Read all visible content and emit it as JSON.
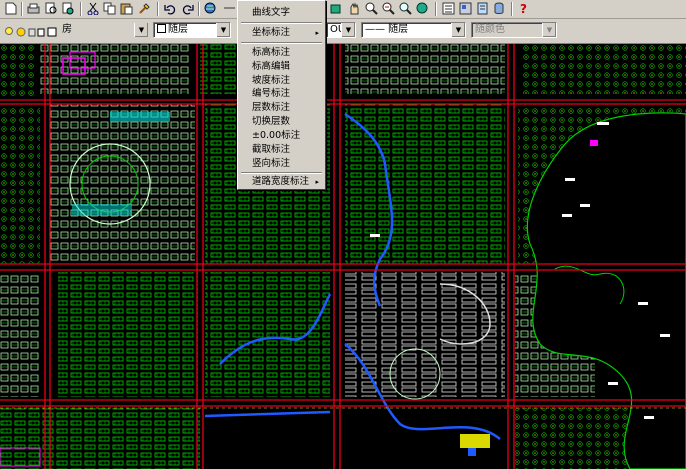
{
  "toolbar": {
    "buttons": [
      "new-icon",
      "print-icon",
      "print-preview-icon",
      "publish-icon",
      "cut-icon",
      "copy-icon",
      "paste-icon",
      "match-properties-icon",
      "undo-icon",
      "redo-icon",
      "globe-icon"
    ],
    "right_buttons": [
      "pan-icon",
      "zoom-realtime-icon",
      "zoom-window-icon",
      "zoom-previous-icon",
      "properties-icon",
      "design-center-icon",
      "tool-palette-icon",
      "help-icon"
    ],
    "help_glyph": "?"
  },
  "layers": {
    "layer_value": "房",
    "color_value": "随层",
    "linetype_value": "OUS",
    "lineweight_value": "—— 随层",
    "plotstyle_value": "随颜色"
  },
  "menu": {
    "items": [
      {
        "label": "曲线文字",
        "submenu": false
      },
      {
        "label": "坐标标注",
        "submenu": true
      },
      {
        "label": "标高标注",
        "submenu": false
      },
      {
        "label": "标高编辑",
        "submenu": false
      },
      {
        "label": "坡度标注",
        "submenu": false
      },
      {
        "label": "编号标注",
        "submenu": false
      },
      {
        "label": "层数标注",
        "submenu": false
      },
      {
        "label": "切换层数",
        "submenu": false
      },
      {
        "label": "±0.00标注",
        "submenu": false
      },
      {
        "label": "截取标注",
        "submenu": false
      },
      {
        "label": "竖向标注",
        "submenu": false
      },
      {
        "label": "道路宽度标注",
        "submenu": true
      }
    ],
    "submenu_arrow": "▸"
  },
  "colors": {
    "background": "#000000",
    "road": "#e8001a",
    "building": "#00d000",
    "building_light": "#c8ffc8",
    "water": "#1e5aff",
    "magenta": "#ff00ff",
    "cyan": "#00e0e0",
    "yellow": "#ffff00",
    "white": "#ffffff"
  }
}
